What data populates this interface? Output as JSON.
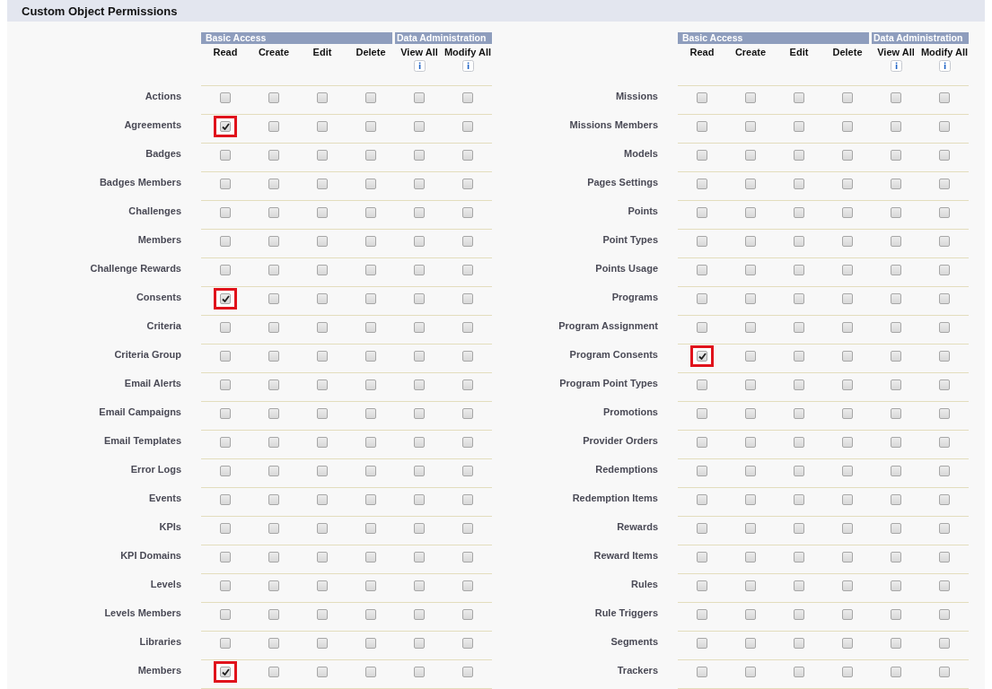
{
  "section": {
    "title": "Custom Object Permissions"
  },
  "tables": [
    {
      "groups": [
        {
          "label": "Basic Access",
          "columns": [
            {
              "label": "Read",
              "info": false
            },
            {
              "label": "Create",
              "info": false
            },
            {
              "label": "Edit",
              "info": false
            },
            {
              "label": "Delete",
              "info": false
            }
          ]
        },
        {
          "label": "Data Administration",
          "columns": [
            {
              "label": "View All",
              "info": true
            },
            {
              "label": "Modify All",
              "info": true
            }
          ]
        }
      ],
      "rows": [
        {
          "label": "Actions",
          "checks": [
            false,
            false,
            false,
            false,
            false,
            false
          ]
        },
        {
          "label": "Agreements",
          "checks": [
            true,
            false,
            false,
            false,
            false,
            false
          ]
        },
        {
          "label": "Badges",
          "checks": [
            false,
            false,
            false,
            false,
            false,
            false
          ]
        },
        {
          "label": "Badges Members",
          "checks": [
            false,
            false,
            false,
            false,
            false,
            false
          ]
        },
        {
          "label": "Challenges",
          "checks": [
            false,
            false,
            false,
            false,
            false,
            false
          ]
        },
        {
          "label": "Members",
          "checks": [
            false,
            false,
            false,
            false,
            false,
            false
          ]
        },
        {
          "label": "Challenge Rewards",
          "checks": [
            false,
            false,
            false,
            false,
            false,
            false
          ]
        },
        {
          "label": "Consents",
          "checks": [
            true,
            false,
            false,
            false,
            false,
            false
          ]
        },
        {
          "label": "Criteria",
          "checks": [
            false,
            false,
            false,
            false,
            false,
            false
          ]
        },
        {
          "label": "Criteria Group",
          "checks": [
            false,
            false,
            false,
            false,
            false,
            false
          ]
        },
        {
          "label": "Email Alerts",
          "checks": [
            false,
            false,
            false,
            false,
            false,
            false
          ]
        },
        {
          "label": "Email Campaigns",
          "checks": [
            false,
            false,
            false,
            false,
            false,
            false
          ]
        },
        {
          "label": "Email Templates",
          "checks": [
            false,
            false,
            false,
            false,
            false,
            false
          ]
        },
        {
          "label": "Error Logs",
          "checks": [
            false,
            false,
            false,
            false,
            false,
            false
          ]
        },
        {
          "label": "Events",
          "checks": [
            false,
            false,
            false,
            false,
            false,
            false
          ]
        },
        {
          "label": "KPIs",
          "checks": [
            false,
            false,
            false,
            false,
            false,
            false
          ]
        },
        {
          "label": "KPI Domains",
          "checks": [
            false,
            false,
            false,
            false,
            false,
            false
          ]
        },
        {
          "label": "Levels",
          "checks": [
            false,
            false,
            false,
            false,
            false,
            false
          ]
        },
        {
          "label": "Levels Members",
          "checks": [
            false,
            false,
            false,
            false,
            false,
            false
          ]
        },
        {
          "label": "Libraries",
          "checks": [
            false,
            false,
            false,
            false,
            false,
            false
          ]
        },
        {
          "label": "Members",
          "checks": [
            true,
            false,
            false,
            false,
            false,
            false
          ]
        }
      ]
    },
    {
      "groups": [
        {
          "label": "Basic Access",
          "columns": [
            {
              "label": "Read",
              "info": false
            },
            {
              "label": "Create",
              "info": false
            },
            {
              "label": "Edit",
              "info": false
            },
            {
              "label": "Delete",
              "info": false
            }
          ]
        },
        {
          "label": "Data Administration",
          "columns": [
            {
              "label": "View All",
              "info": true
            },
            {
              "label": "Modify All",
              "info": true
            }
          ]
        }
      ],
      "rows": [
        {
          "label": "Missions",
          "checks": [
            false,
            false,
            false,
            false,
            false,
            false
          ]
        },
        {
          "label": "Missions Members",
          "checks": [
            false,
            false,
            false,
            false,
            false,
            false
          ]
        },
        {
          "label": "Models",
          "checks": [
            false,
            false,
            false,
            false,
            false,
            false
          ]
        },
        {
          "label": "Pages Settings",
          "checks": [
            false,
            false,
            false,
            false,
            false,
            false
          ]
        },
        {
          "label": "Points",
          "checks": [
            false,
            false,
            false,
            false,
            false,
            false
          ]
        },
        {
          "label": "Point Types",
          "checks": [
            false,
            false,
            false,
            false,
            false,
            false
          ]
        },
        {
          "label": "Points Usage",
          "checks": [
            false,
            false,
            false,
            false,
            false,
            false
          ]
        },
        {
          "label": "Programs",
          "checks": [
            false,
            false,
            false,
            false,
            false,
            false
          ]
        },
        {
          "label": "Program Assignment",
          "checks": [
            false,
            false,
            false,
            false,
            false,
            false
          ]
        },
        {
          "label": "Program Consents",
          "checks": [
            true,
            false,
            false,
            false,
            false,
            false
          ]
        },
        {
          "label": "Program Point Types",
          "checks": [
            false,
            false,
            false,
            false,
            false,
            false
          ]
        },
        {
          "label": "Promotions",
          "checks": [
            false,
            false,
            false,
            false,
            false,
            false
          ]
        },
        {
          "label": "Provider Orders",
          "checks": [
            false,
            false,
            false,
            false,
            false,
            false
          ]
        },
        {
          "label": "Redemptions",
          "checks": [
            false,
            false,
            false,
            false,
            false,
            false
          ]
        },
        {
          "label": "Redemption Items",
          "checks": [
            false,
            false,
            false,
            false,
            false,
            false
          ]
        },
        {
          "label": "Rewards",
          "checks": [
            false,
            false,
            false,
            false,
            false,
            false
          ]
        },
        {
          "label": "Reward Items",
          "checks": [
            false,
            false,
            false,
            false,
            false,
            false
          ]
        },
        {
          "label": "Rules",
          "checks": [
            false,
            false,
            false,
            false,
            false,
            false
          ]
        },
        {
          "label": "Rule Triggers",
          "checks": [
            false,
            false,
            false,
            false,
            false,
            false
          ]
        },
        {
          "label": "Segments",
          "checks": [
            false,
            false,
            false,
            false,
            false,
            false
          ]
        },
        {
          "label": "Trackers",
          "checks": [
            false,
            false,
            false,
            false,
            false,
            false
          ]
        }
      ]
    }
  ]
}
